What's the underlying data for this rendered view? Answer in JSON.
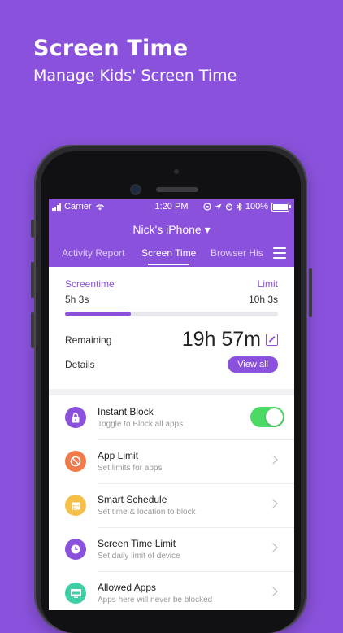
{
  "hero": {
    "title": "Screen Time",
    "subtitle": "Manage Kids' Screen Time"
  },
  "status_bar": {
    "carrier": "Carrier",
    "time": "1:20 PM",
    "battery": "100%"
  },
  "header": {
    "device_name": "Nick's iPhone ▾"
  },
  "tabs": [
    {
      "label": "Activity Report",
      "active": false
    },
    {
      "label": "Screen Time",
      "active": true
    },
    {
      "label": "Browser His",
      "active": false
    }
  ],
  "summary": {
    "screentime_label": "Screentime",
    "limit_label": "Limit",
    "screentime_value": "5h 3s",
    "limit_value": "10h 3s",
    "progress_fraction": 0.31,
    "remaining_label": "Remaining",
    "remaining_value": "19h 57m",
    "details_label": "Details",
    "view_all_label": "View all"
  },
  "colors": {
    "brand": "#8a52dc",
    "toggle_on": "#4cd964"
  },
  "features": [
    {
      "title": "Instant Block",
      "subtitle": "Toggle to Block all apps",
      "icon": "lock-icon",
      "color": "#8a52dc",
      "control": "toggle",
      "toggle_on": true
    },
    {
      "title": "App Limit",
      "subtitle": "Set limits for apps",
      "icon": "prohibit-icon",
      "color": "#f07a4a",
      "control": "chevron"
    },
    {
      "title": "Smart Schedule",
      "subtitle": "Set time & location to block",
      "icon": "calendar-icon",
      "color": "#f5c04a",
      "control": "chevron"
    },
    {
      "title": "Screen Time Limit",
      "subtitle": "Set daily limit of device",
      "icon": "clock-icon",
      "color": "#8a52dc",
      "control": "chevron"
    },
    {
      "title": "Allowed Apps",
      "subtitle": "Apps here will never be blocked",
      "icon": "app-icon",
      "color": "#3ecfa6",
      "control": "chevron"
    }
  ]
}
